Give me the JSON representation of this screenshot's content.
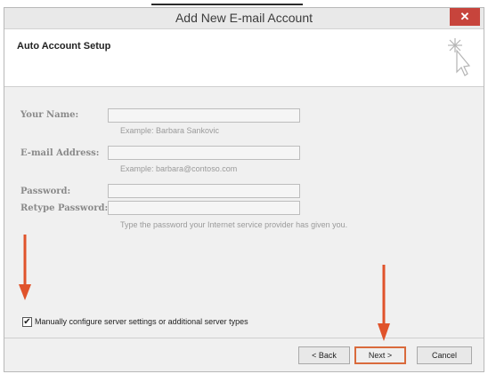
{
  "window": {
    "title": "Add New E-mail Account",
    "close_glyph": "✕"
  },
  "header": {
    "heading": "Auto Account Setup",
    "icon": "wizard-cursor-icon"
  },
  "form": {
    "name_label": "Your Name:",
    "name_value": "",
    "name_example": "Example: Barbara Sankovic",
    "email_label": "E-mail Address:",
    "email_value": "",
    "email_example": "Example: barbara@contoso.com",
    "password_label": "Password:",
    "password_value": "",
    "retype_label": "Retype Password:",
    "retype_value": "",
    "password_hint": "Type the password your Internet service provider has given you."
  },
  "manual": {
    "checked": true,
    "check_glyph": "✔",
    "label": "Manually configure server settings or additional server types"
  },
  "buttons": {
    "back": "< Back",
    "next": "Next >",
    "cancel": "Cancel"
  },
  "colors": {
    "annotation_arrow": "#e0532b",
    "close_button": "#c7443c"
  }
}
